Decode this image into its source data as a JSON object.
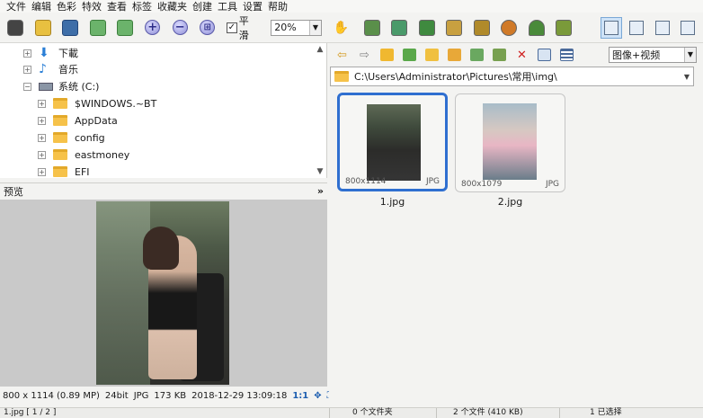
{
  "menu": [
    "文件",
    "编辑",
    "色彩",
    "特效",
    "查看",
    "标签",
    "收藏夹",
    "创建",
    "工具",
    "设置",
    "帮助"
  ],
  "toolbar": {
    "checkbox_label": "平滑",
    "checkbox_checked": true,
    "zoom_value": "20%",
    "zoom_minus_glyph": "−",
    "zoom_plus_glyph": "+",
    "zoom_fit_glyph": "⊞"
  },
  "tree": {
    "items": [
      {
        "label": "下載",
        "icon": "download-arrow-icon",
        "icon_color": "#2b7fd6"
      },
      {
        "label": "音乐",
        "icon": "music-note-icon",
        "icon_color": "#2b7fd6"
      },
      {
        "label": "系统 (C:)",
        "icon": "drive-icon",
        "icon_color": "#2b7fd6"
      },
      {
        "label": "$WINDOWS.~BT",
        "icon": "folder-icon"
      },
      {
        "label": "AppData",
        "icon": "folder-icon"
      },
      {
        "label": "config",
        "icon": "folder-icon"
      },
      {
        "label": "eastmoney",
        "icon": "folder-icon"
      },
      {
        "label": "EFI",
        "icon": "folder-icon"
      }
    ]
  },
  "preview": {
    "title": "预览",
    "collapse_glyph": "»",
    "info": {
      "dimensions": "800 x 1114 (0.89 MP)",
      "bitdepth": "24bit",
      "format": "JPG",
      "size": "173 KB",
      "datetime": "2018-12-29 13:09:18",
      "ratio": "1:1"
    }
  },
  "filter": {
    "value": "图像+视频"
  },
  "address": {
    "path": "C:\\Users\\Administrator\\Pictures\\常用\\img\\"
  },
  "thumbnails": [
    {
      "name": "1.jpg",
      "dims": "800x1114",
      "format": "JPG",
      "selected": true
    },
    {
      "name": "2.jpg",
      "dims": "800x1079",
      "format": "JPG",
      "selected": false
    }
  ],
  "status": {
    "file": "1.jpg [ 1 / 2 ]",
    "folders": "0 个文件夹",
    "files": "2 个文件 (410 KB)",
    "selected": "1 已选择"
  },
  "colors": {
    "accent": "#2f6fd0",
    "folder": "#f6c24a",
    "selection_bg": "#cfe3f7"
  },
  "icons": {
    "arrow_left": "⇦",
    "arrow_right": "⇨",
    "close_x": "✕",
    "hand": "✋",
    "dropdown": "▼",
    "scroll_up": "▲",
    "scroll_down": "▼"
  }
}
